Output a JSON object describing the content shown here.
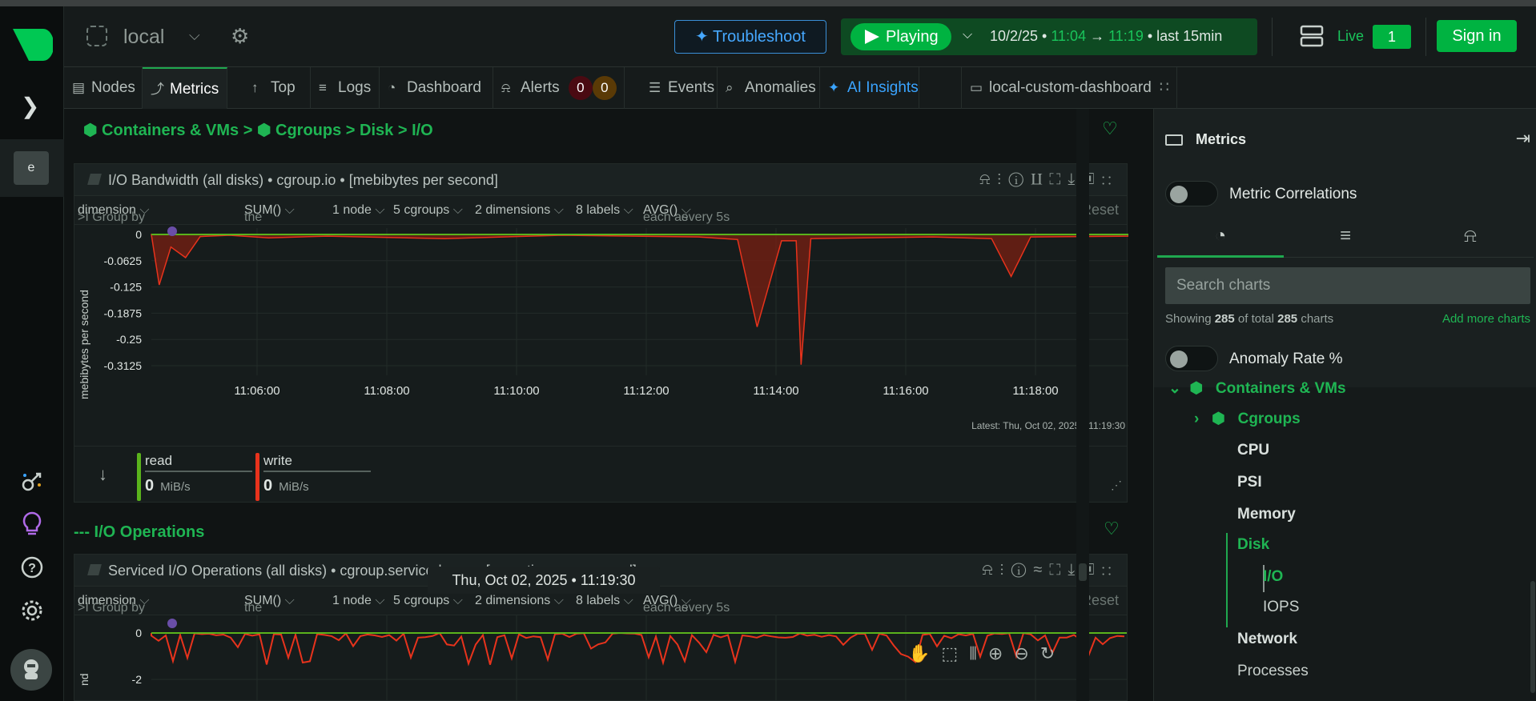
{
  "header": {
    "room_name": "local",
    "troubleshoot_label": "Troubleshoot",
    "play_label": "Playing",
    "time_date": "10/2/25 •",
    "time_from": "11:04",
    "time_arrow": "→",
    "time_to": "11:19",
    "time_suffix": "• last  15min",
    "live_label": "Live",
    "live_count": "1",
    "signin_label": "Sign in"
  },
  "rail": {
    "space_initial": "e"
  },
  "tabs": [
    {
      "label": "Nodes",
      "icon": "nodes-icon"
    },
    {
      "label": "Metrics",
      "icon": "metrics-icon"
    },
    {
      "label": "Top",
      "icon": "top-icon"
    },
    {
      "label": "Logs",
      "icon": "logs-icon"
    },
    {
      "label": "Dashboard",
      "icon": "dashboard-icon"
    },
    {
      "label": "Alerts",
      "icon": "bell-icon"
    },
    {
      "label": "Events",
      "icon": "events-icon"
    },
    {
      "label": "Anomalies",
      "icon": "anomalies-icon"
    },
    {
      "label": "AI Insights",
      "icon": "sparkle-icon"
    },
    {
      "label": "local-custom-dashboard",
      "icon": "dashboard-card-icon"
    }
  ],
  "alerts": {
    "critical": "0",
    "warning": "0",
    "critical_color": "#4a0a12",
    "warning_color": "#5a3a06"
  },
  "breadcrumb": {
    "text": "Containers & VMs >  Cgroups > Disk > I/O",
    "part1": "Containers & VMs >",
    "part2": "Cgroups > Disk > I/O"
  },
  "chart1": {
    "title": "I/O Bandwidth (all disks) • cgroup.io • [mebibytes per second]",
    "group_by_prefix": ">I Group by",
    "group_by_value": "dimension",
    "agg_prefix": "the",
    "agg_value": "SUM()",
    "nodes": "1 node",
    "cgroups": "5 cgroups",
    "dimensions": "2 dimensions",
    "labels": "8 labels",
    "each_as": "each as",
    "each_value": "AVG()",
    "every": "every 5s",
    "reset": "Reset",
    "y_axis_label": "mebibytes per second",
    "latest": "Latest:  Thu, Oct 02, 2025 • 11:19:30",
    "legend": [
      {
        "name": "read",
        "value": "0",
        "unit": "MiB/s",
        "color": "#5ab31c"
      },
      {
        "name": "write",
        "value": "0",
        "unit": "MiB/s",
        "color": "#e8331c"
      }
    ]
  },
  "section2_title": "--- I/O Operations",
  "chart2": {
    "title": "Serviced I/O Operations (all disks) • cgroup.serviced_ops • [operations per second]",
    "group_by_prefix": ">I Group by",
    "group_by_value": "dimension",
    "agg_prefix": "the",
    "agg_value": "SUM()",
    "nodes": "1 node",
    "cgroups": "5 cgroups",
    "dimensions": "2 dimensions",
    "labels": "8 labels",
    "each_as": "each as",
    "each_value": "AVG()",
    "every": "every 5s",
    "reset": "Reset",
    "y_axis_label": "nd"
  },
  "chart_data": [
    {
      "type": "area",
      "title": "I/O Bandwidth (all disks)",
      "ylabel": "mebibytes per second",
      "ylim": [
        -0.3125,
        0
      ],
      "yticks": [
        "0",
        "-0.0625",
        "-0.125",
        "-0.1875",
        "-0.25",
        "-0.3125"
      ],
      "x_ticks": [
        "11:06:00",
        "11:08:00",
        "11:10:00",
        "11:12:00",
        "11:14:00",
        "11:16:00",
        "11:18:00"
      ],
      "x_range": [
        "11:04:15",
        "11:19:30"
      ],
      "series": [
        {
          "name": "read",
          "color": "#5ab31c",
          "values": [
            [
              0,
              0
            ]
          ]
        },
        {
          "name": "write",
          "color": "#e8331c",
          "values": [
            [
              0.0,
              0
            ],
            [
              0.008,
              -0.12
            ],
            [
              0.02,
              -0.03
            ],
            [
              0.035,
              -0.055
            ],
            [
              0.05,
              -0.005
            ],
            [
              0.08,
              -0.002
            ],
            [
              0.12,
              -0.008
            ],
            [
              0.18,
              -0.004
            ],
            [
              0.3,
              -0.01
            ],
            [
              0.42,
              -0.002
            ],
            [
              0.56,
              -0.006
            ],
            [
              0.6,
              -0.012
            ],
            [
              0.62,
              -0.22
            ],
            [
              0.645,
              -0.015
            ],
            [
              0.66,
              -0.015
            ],
            [
              0.665,
              -0.31
            ],
            [
              0.675,
              -0.01
            ],
            [
              0.8,
              -0.006
            ],
            [
              0.86,
              -0.01
            ],
            [
              0.88,
              -0.1
            ],
            [
              0.9,
              -0.006
            ],
            [
              1.0,
              -0.004
            ]
          ]
        }
      ]
    },
    {
      "type": "line",
      "title": "Serviced I/O Operations (all disks)",
      "ylabel": "nd",
      "yticks": [
        "0",
        "-2"
      ],
      "series": [
        {
          "name": "read",
          "color": "#5ab31c"
        },
        {
          "name": "write",
          "color": "#e8331c"
        }
      ]
    }
  ],
  "footer_date": "Thu, Oct 02, 2025 • 11:19:30",
  "right_panel": {
    "title": "Metrics",
    "metric_correlations": "Metric Correlations",
    "search_placeholder": "Search charts",
    "showing_prefix": "Showing",
    "showing_count": "285",
    "showing_mid": "of total",
    "showing_total": "285",
    "showing_suffix": "charts",
    "add_more": "Add more charts",
    "anomaly_rate": "Anomaly Rate %",
    "tree": {
      "containers": "Containers & VMs",
      "cgroups": "Cgroups",
      "cpu": "CPU",
      "psi": "PSI",
      "memory": "Memory",
      "disk": "Disk",
      "io": "I/O",
      "iops": "IOPS",
      "network": "Network",
      "processes": "Processes"
    }
  }
}
